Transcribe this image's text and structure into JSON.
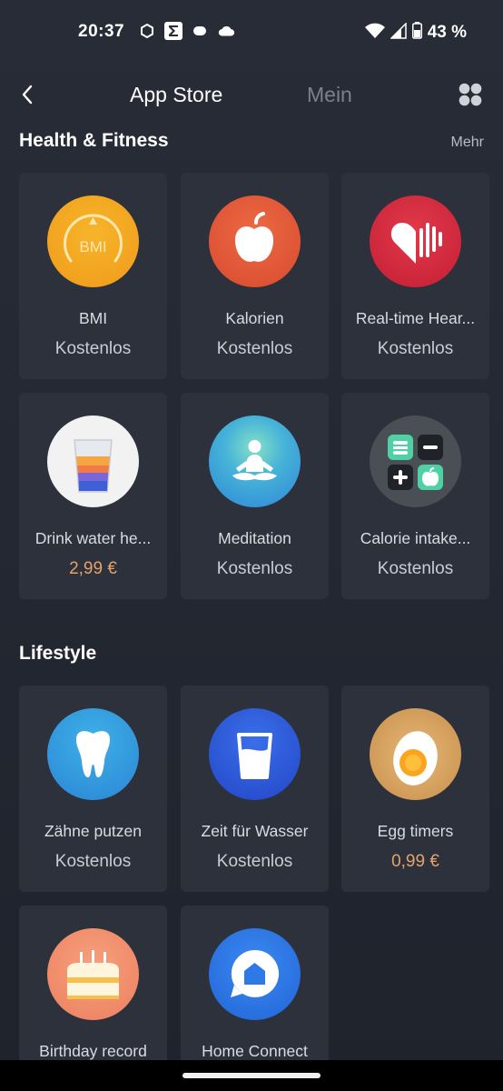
{
  "status_bar": {
    "time": "20:37",
    "battery_text": "43 %",
    "icons_left": [
      "hexagon-icon",
      "sigma-icon",
      "notification-app-icon",
      "cloud-icon"
    ],
    "icons_right": [
      "wifi-icon",
      "signal-icon",
      "battery-icon"
    ]
  },
  "header": {
    "back_icon": "chevron-left-icon",
    "tab_active": "App Store",
    "tab_inactive": "Mein",
    "grid_icon": "grid-icon"
  },
  "sections": [
    {
      "title": "Health & Fitness",
      "more": "Mehr",
      "apps": [
        {
          "name": "BMI",
          "price": "Kostenlos",
          "icon": "bmi-icon",
          "color": "#f3a51f"
        },
        {
          "name": "Kalorien",
          "price": "Kostenlos",
          "icon": "apple-icon",
          "color": "#e2573a"
        },
        {
          "name": "Real-time Hear...",
          "price": "Kostenlos",
          "icon": "heart-rate-icon",
          "color": "#d92b3f"
        },
        {
          "name": "Drink water he...",
          "price": "2,99 €",
          "icon": "water-glass-icon",
          "color": "#f4f4f4"
        },
        {
          "name": "Meditation",
          "price": "Kostenlos",
          "icon": "meditation-icon",
          "color": "#3a9ee0"
        },
        {
          "name": "Calorie intake...",
          "price": "Kostenlos",
          "icon": "calculator-icon",
          "color": "#4a4e55"
        }
      ]
    },
    {
      "title": "Lifestyle",
      "apps": [
        {
          "name": "Zähne putzen",
          "price": "Kostenlos",
          "icon": "tooth-icon",
          "color": "#2f9be0"
        },
        {
          "name": "Zeit für Wasser",
          "price": "Kostenlos",
          "icon": "cup-icon",
          "color": "#2d5ce0"
        },
        {
          "name": "Egg timers",
          "price": "0,99 €",
          "icon": "egg-icon",
          "color": "#d9a868"
        },
        {
          "name": "Birthday record",
          "price": "",
          "icon": "cake-icon",
          "color": "#f08a6c"
        },
        {
          "name": "Home Connect",
          "price": "",
          "icon": "home-connect-icon",
          "color": "#2f78e8"
        }
      ]
    }
  ]
}
